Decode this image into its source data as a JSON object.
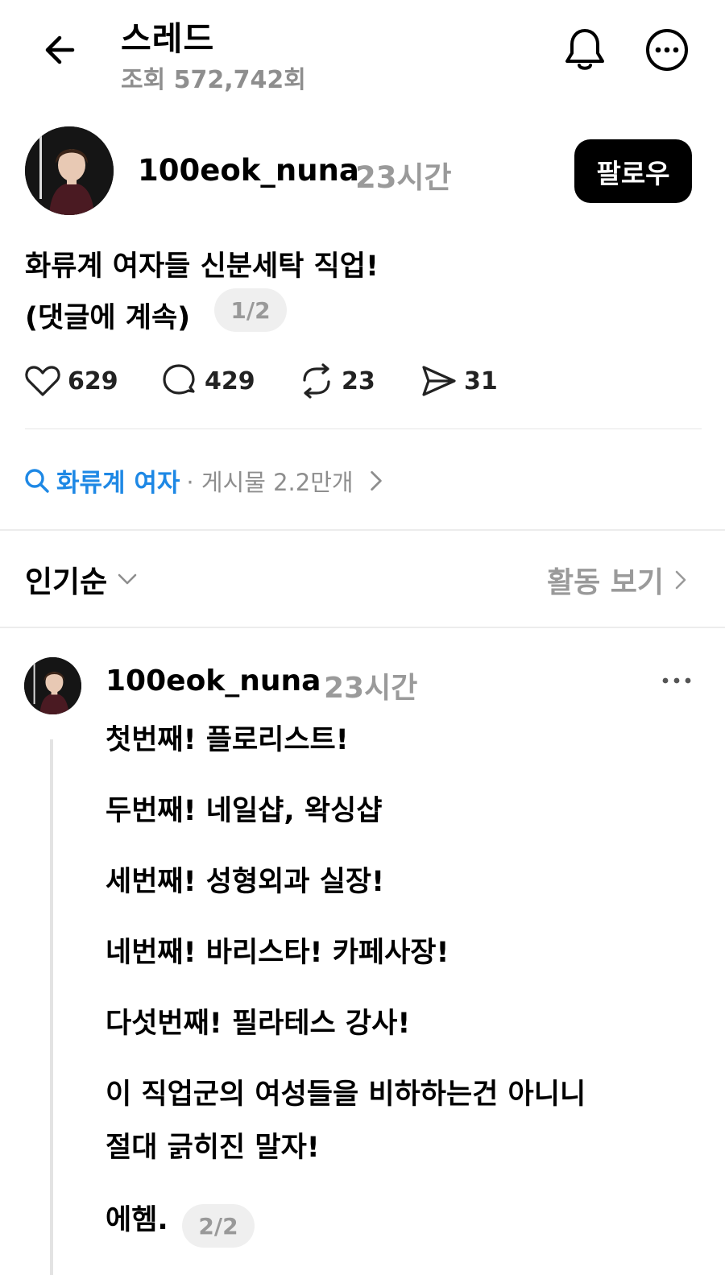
{
  "header": {
    "title": "스레드",
    "views": "조회 572,742회",
    "icons": [
      "back-arrow-icon",
      "bell-icon",
      "more-icon"
    ]
  },
  "post": {
    "author": "100eok_nuna",
    "time": "23시간",
    "follow_label": "팔로우",
    "text_line1": "화류계 여자들 신분세탁 직업!",
    "text_line2": "(댓글에 계속)",
    "page_indicator": "1/2",
    "stats": {
      "likes": "629",
      "comments": "429",
      "reposts": "23",
      "shares": "31"
    }
  },
  "tag": {
    "label": "화류계 여자",
    "meta": "· 게시물 2.2만개"
  },
  "sort": {
    "label": "인기순",
    "activity_label": "활동 보기"
  },
  "reply": {
    "author": "100eok_nuna",
    "time": "23시간",
    "lines": [
      "첫번째! 플로리스트!",
      "두번째! 네일샵, 왁싱샵",
      "세번째! 성형외과 실장!",
      "네번째! 바리스타! 카페사장!",
      "다섯번째! 필라테스 강사!",
      "이 직업군의 여성들을 비하하는건 아니니",
      "절대 긁히진 말자!",
      "에헴."
    ],
    "page_indicator": "2/2"
  },
  "colors": {
    "accent": "#1e88e5",
    "muted": "#9a9a9a",
    "follow_bg": "#000000",
    "pill_bg": "#efefef"
  }
}
